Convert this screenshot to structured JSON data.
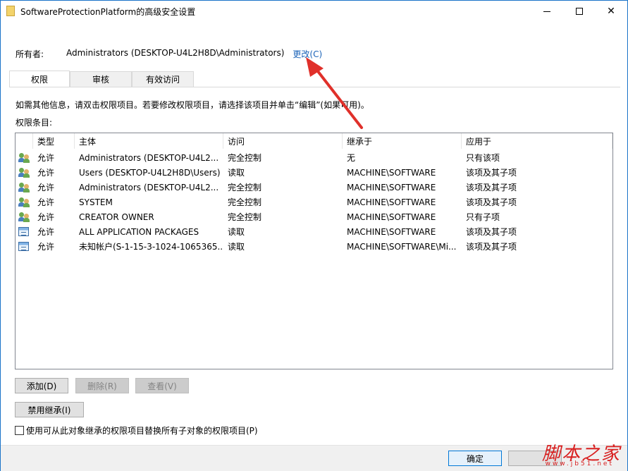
{
  "window": {
    "title": "SoftwareProtectionPlatform的高级安全设置",
    "title_icon": "folder-icon"
  },
  "owner": {
    "label": "所有者:",
    "value": "Administrators (DESKTOP-U4L2H8D\\Administrators)",
    "change_link": "更改(C)"
  },
  "tabs": [
    {
      "label": "权限",
      "active": true
    },
    {
      "label": "审核",
      "active": false
    },
    {
      "label": "有效访问",
      "active": false
    }
  ],
  "info_text": "如需其他信息，请双击权限项目。若要修改权限项目，请选择该项目并单击“编辑”(如果可用)。",
  "entries_label": "权限条目:",
  "grid": {
    "columns": [
      "",
      "类型",
      "主体",
      "访问",
      "继承于",
      "应用于"
    ],
    "rows": [
      {
        "icon": "users-icon",
        "type": "允许",
        "principal": "Administrators (DESKTOP-U4L2...",
        "access": "完全控制",
        "inherited_from": "无",
        "applies_to": "只有该项"
      },
      {
        "icon": "users-icon",
        "type": "允许",
        "principal": "Users (DESKTOP-U4L2H8D\\Users)",
        "access": "读取",
        "inherited_from": "MACHINE\\SOFTWARE",
        "applies_to": "该项及其子项"
      },
      {
        "icon": "users-icon",
        "type": "允许",
        "principal": "Administrators (DESKTOP-U4L2...",
        "access": "完全控制",
        "inherited_from": "MACHINE\\SOFTWARE",
        "applies_to": "该项及其子项"
      },
      {
        "icon": "users-icon",
        "type": "允许",
        "principal": "SYSTEM",
        "access": "完全控制",
        "inherited_from": "MACHINE\\SOFTWARE",
        "applies_to": "该项及其子项"
      },
      {
        "icon": "users-icon",
        "type": "允许",
        "principal": "CREATOR OWNER",
        "access": "完全控制",
        "inherited_from": "MACHINE\\SOFTWARE",
        "applies_to": "只有子项"
      },
      {
        "icon": "package-icon",
        "type": "允许",
        "principal": "ALL APPLICATION PACKAGES",
        "access": "读取",
        "inherited_from": "MACHINE\\SOFTWARE",
        "applies_to": "该项及其子项"
      },
      {
        "icon": "package-icon",
        "type": "允许",
        "principal": "未知帐户(S-1-15-3-1024-1065365...",
        "access": "读取",
        "inherited_from": "MACHINE\\SOFTWARE\\Mi...",
        "applies_to": "该项及其子项"
      }
    ]
  },
  "buttons": {
    "add": "添加(D)",
    "delete": "删除(R)",
    "view": "查看(V)",
    "disable_inheritance": "禁用继承(I)",
    "ok": "确定"
  },
  "replace_checkbox": {
    "label": "使用可从此对象继承的权限项目替换所有子对象的权限项目(P)",
    "checked": false
  },
  "watermark": {
    "cn": "脚本之家",
    "en": "www.jb51.net"
  },
  "colors": {
    "link": "#1b63b8",
    "arrow": "#e0302a",
    "accent": "#0078d7"
  }
}
